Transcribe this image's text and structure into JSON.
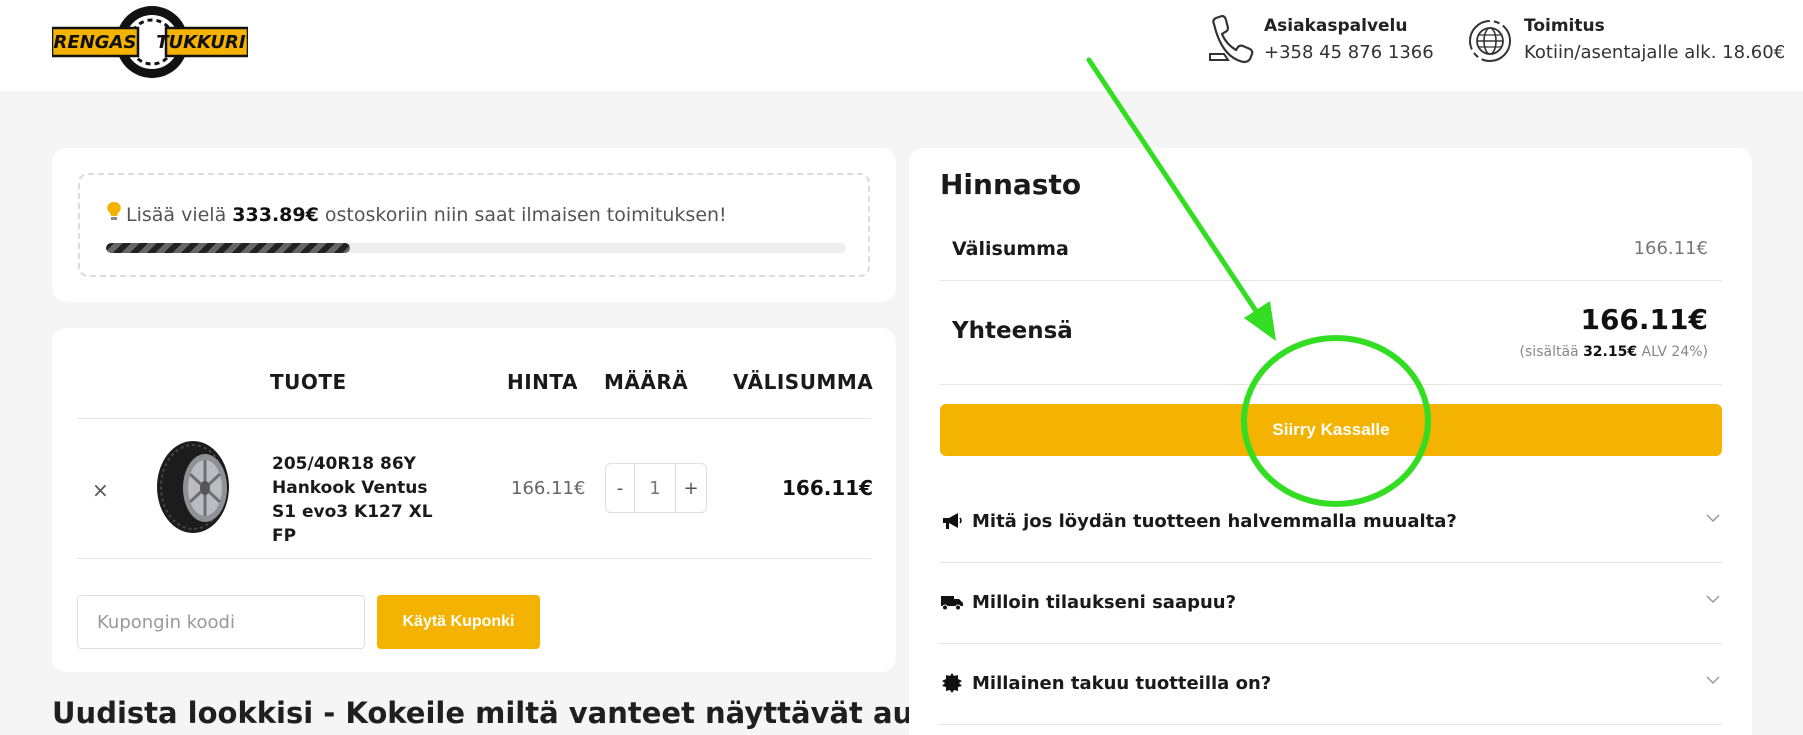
{
  "header": {
    "logo_word_1": "RENGAS",
    "logo_word_2": "TUKKURIT",
    "customer_service_label": "Asiakaspalvelu",
    "customer_service_phone": "+358 45 876 1366",
    "delivery_label": "Toimitus",
    "delivery_text": "Kotiin/asentajalle alk. 18.60€"
  },
  "shipping_notice": {
    "prefix": "Lisää vielä",
    "amount": "333.89€",
    "suffix": "ostoskoriin niin saat ilmaisen toimituksen!",
    "progress_percent": 33
  },
  "cart": {
    "columns": [
      "TUOTE",
      "HINTA",
      "MÄÄRÄ",
      "VÄLISUMMA"
    ],
    "items": [
      {
        "remove_symbol": "×",
        "name": "205/40R18 86Y Hankook Ventus S1 evo3 K127 XL FP",
        "price": "166.11€",
        "quantity": "1",
        "qty_minus": "-",
        "qty_plus": "+",
        "subtotal": "166.11€"
      }
    ],
    "coupon_placeholder": "Kupongin koodi",
    "coupon_button": "Käytä Kuponki"
  },
  "section_title": "Uudista lookkisi - Kokeile miltä vanteet näyttävät autollasi",
  "pricing": {
    "title": "Hinnasto",
    "subtotal_label": "Välisumma",
    "subtotal_value": "166.11€",
    "total_label": "Yhteensä",
    "total_value": "166.11€",
    "vat_prefix": "(sisältää",
    "vat_amount": "32.15€",
    "vat_suffix": "ALV 24%)",
    "checkout_button": "Siirry Kassalle",
    "faq": [
      {
        "question": "Mitä jos löydän tuotteen halvemmalla muualta?",
        "icon": "megaphone-icon"
      },
      {
        "question": "Milloin tilaukseni saapuu?",
        "icon": "truck-icon"
      },
      {
        "question": "Millainen takuu tuotteilla on?",
        "icon": "badge-icon"
      }
    ]
  },
  "colors": {
    "accent": "#f5b301",
    "annotation_green": "#33dd22",
    "page_bg": "#f5f5f5"
  }
}
